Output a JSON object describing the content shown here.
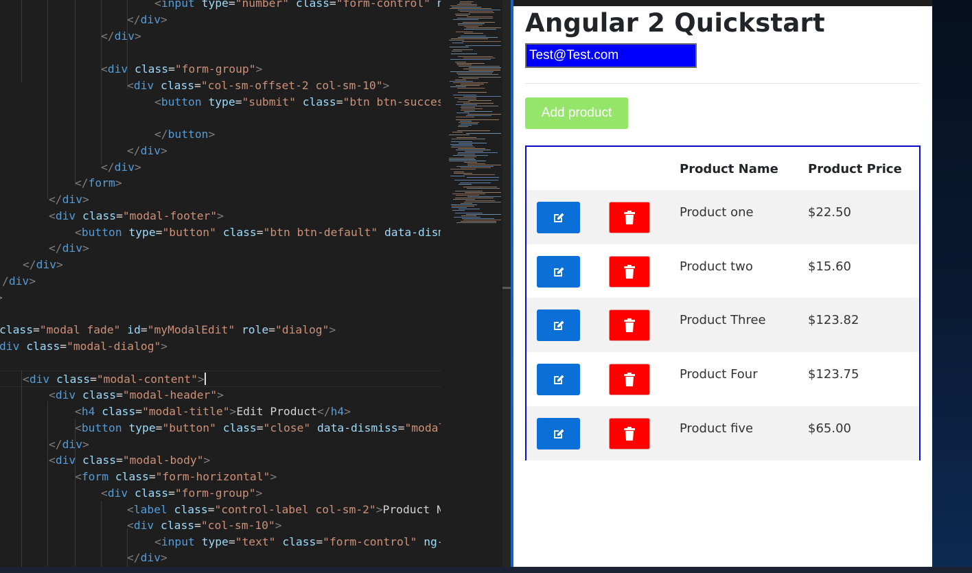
{
  "editor": {
    "lines": [
      [
        [
          "t-punc",
          "<"
        ],
        [
          "t-tag",
          "input"
        ],
        [
          "t-text",
          " "
        ],
        [
          "t-attr",
          "type"
        ],
        [
          "t-text",
          "="
        ],
        [
          "t-str",
          "\"number\""
        ],
        [
          "t-text",
          " "
        ],
        [
          "t-attr",
          "class"
        ],
        [
          "t-text",
          "="
        ],
        [
          "t-str",
          "\"form-control\""
        ],
        [
          "t-text",
          " "
        ],
        [
          "t-attr",
          "ng"
        ]
      ],
      [
        [
          "t-punc",
          "</"
        ],
        [
          "t-tag",
          "div"
        ],
        [
          "t-punc",
          ">"
        ]
      ],
      [
        [
          "t-punc",
          "</"
        ],
        [
          "t-tag",
          "div"
        ],
        [
          "t-punc",
          ">"
        ]
      ],
      [],
      [
        [
          "t-punc",
          "<"
        ],
        [
          "t-tag",
          "div"
        ],
        [
          "t-text",
          " "
        ],
        [
          "t-attr",
          "class"
        ],
        [
          "t-text",
          "="
        ],
        [
          "t-str",
          "\"form-group\""
        ],
        [
          "t-punc",
          ">"
        ]
      ],
      [
        [
          "t-punc",
          "<"
        ],
        [
          "t-tag",
          "div"
        ],
        [
          "t-text",
          " "
        ],
        [
          "t-attr",
          "class"
        ],
        [
          "t-text",
          "="
        ],
        [
          "t-str",
          "\"col-sm-offset-2 col-sm-10\""
        ],
        [
          "t-punc",
          ">"
        ]
      ],
      [
        [
          "t-punc",
          "<"
        ],
        [
          "t-tag",
          "button"
        ],
        [
          "t-text",
          " "
        ],
        [
          "t-attr",
          "type"
        ],
        [
          "t-text",
          "="
        ],
        [
          "t-str",
          "\"submit\""
        ],
        [
          "t-text",
          " "
        ],
        [
          "t-attr",
          "class"
        ],
        [
          "t-text",
          "="
        ],
        [
          "t-str",
          "\"btn btn-success"
        ]
      ],
      [],
      [
        [
          "t-punc",
          "</"
        ],
        [
          "t-tag",
          "button"
        ],
        [
          "t-punc",
          ">"
        ]
      ],
      [
        [
          "t-punc",
          "</"
        ],
        [
          "t-tag",
          "div"
        ],
        [
          "t-punc",
          ">"
        ]
      ],
      [
        [
          "t-punc",
          "</"
        ],
        [
          "t-tag",
          "div"
        ],
        [
          "t-punc",
          ">"
        ]
      ],
      [
        [
          "t-punc",
          "</"
        ],
        [
          "t-tag",
          "form"
        ],
        [
          "t-punc",
          ">"
        ]
      ],
      [
        [
          "t-punc",
          "</"
        ],
        [
          "t-tag",
          "div"
        ],
        [
          "t-punc",
          ">"
        ]
      ],
      [
        [
          "t-punc",
          "<"
        ],
        [
          "t-tag",
          "div"
        ],
        [
          "t-text",
          " "
        ],
        [
          "t-attr",
          "class"
        ],
        [
          "t-text",
          "="
        ],
        [
          "t-str",
          "\"modal-footer\""
        ],
        [
          "t-punc",
          ">"
        ]
      ],
      [
        [
          "t-punc",
          "<"
        ],
        [
          "t-tag",
          "button"
        ],
        [
          "t-text",
          " "
        ],
        [
          "t-attr",
          "type"
        ],
        [
          "t-text",
          "="
        ],
        [
          "t-str",
          "\"button\""
        ],
        [
          "t-text",
          " "
        ],
        [
          "t-attr",
          "class"
        ],
        [
          "t-text",
          "="
        ],
        [
          "t-str",
          "\"btn btn-default\""
        ],
        [
          "t-text",
          " "
        ],
        [
          "t-attr",
          "data-dismi"
        ]
      ],
      [
        [
          "t-punc",
          "</"
        ],
        [
          "t-tag",
          "div"
        ],
        [
          "t-punc",
          ">"
        ]
      ],
      [
        [
          "t-punc",
          "</"
        ],
        [
          "t-tag",
          "div"
        ],
        [
          "t-punc",
          ">"
        ]
      ],
      [
        [
          "t-punc",
          "/"
        ],
        [
          "t-tag",
          "div"
        ],
        [
          "t-punc",
          ">"
        ]
      ],
      [
        [
          "t-punc",
          ">"
        ]
      ],
      [],
      [
        [
          "t-attr",
          "class"
        ],
        [
          "t-text",
          "="
        ],
        [
          "t-str",
          "\"modal fade\""
        ],
        [
          "t-text",
          " "
        ],
        [
          "t-attr",
          "id"
        ],
        [
          "t-text",
          "="
        ],
        [
          "t-str",
          "\"myModalEdit\""
        ],
        [
          "t-text",
          " "
        ],
        [
          "t-attr",
          "role"
        ],
        [
          "t-text",
          "="
        ],
        [
          "t-str",
          "\"dialog\""
        ],
        [
          "t-punc",
          ">"
        ]
      ],
      [
        [
          "t-tag",
          "div"
        ],
        [
          "t-text",
          " "
        ],
        [
          "t-attr",
          "class"
        ],
        [
          "t-text",
          "="
        ],
        [
          "t-str",
          "\"modal-dialog\""
        ],
        [
          "t-punc",
          ">"
        ]
      ],
      [],
      [
        [
          "t-punc",
          "<"
        ],
        [
          "t-tag",
          "div"
        ],
        [
          "t-text",
          " "
        ],
        [
          "t-attr",
          "class"
        ],
        [
          "t-text",
          "="
        ],
        [
          "t-str",
          "\"modal-content\""
        ],
        [
          "t-punc",
          ">"
        ]
      ],
      [
        [
          "t-punc",
          "<"
        ],
        [
          "t-tag",
          "div"
        ],
        [
          "t-text",
          " "
        ],
        [
          "t-attr",
          "class"
        ],
        [
          "t-text",
          "="
        ],
        [
          "t-str",
          "\"modal-header\""
        ],
        [
          "t-punc",
          ">"
        ]
      ],
      [
        [
          "t-punc",
          "<"
        ],
        [
          "t-tag",
          "h4"
        ],
        [
          "t-text",
          " "
        ],
        [
          "t-attr",
          "class"
        ],
        [
          "t-text",
          "="
        ],
        [
          "t-str",
          "\"modal-title\""
        ],
        [
          "t-punc",
          ">"
        ],
        [
          "t-text",
          "Edit Product"
        ],
        [
          "t-punc",
          "</"
        ],
        [
          "t-tag",
          "h4"
        ],
        [
          "t-punc",
          ">"
        ]
      ],
      [
        [
          "t-punc",
          "<"
        ],
        [
          "t-tag",
          "button"
        ],
        [
          "t-text",
          " "
        ],
        [
          "t-attr",
          "type"
        ],
        [
          "t-text",
          "="
        ],
        [
          "t-str",
          "\"button\""
        ],
        [
          "t-text",
          " "
        ],
        [
          "t-attr",
          "class"
        ],
        [
          "t-text",
          "="
        ],
        [
          "t-str",
          "\"close\""
        ],
        [
          "t-text",
          " "
        ],
        [
          "t-attr",
          "data-dismiss"
        ],
        [
          "t-text",
          "="
        ],
        [
          "t-str",
          "\"modal\""
        ]
      ],
      [
        [
          "t-punc",
          "</"
        ],
        [
          "t-tag",
          "div"
        ],
        [
          "t-punc",
          ">"
        ]
      ],
      [
        [
          "t-punc",
          "<"
        ],
        [
          "t-tag",
          "div"
        ],
        [
          "t-text",
          " "
        ],
        [
          "t-attr",
          "class"
        ],
        [
          "t-text",
          "="
        ],
        [
          "t-str",
          "\"modal-body\""
        ],
        [
          "t-punc",
          ">"
        ]
      ],
      [
        [
          "t-punc",
          "<"
        ],
        [
          "t-tag",
          "form"
        ],
        [
          "t-text",
          " "
        ],
        [
          "t-attr",
          "class"
        ],
        [
          "t-text",
          "="
        ],
        [
          "t-str",
          "\"form-horizontal\""
        ],
        [
          "t-punc",
          ">"
        ]
      ],
      [
        [
          "t-punc",
          "<"
        ],
        [
          "t-tag",
          "div"
        ],
        [
          "t-text",
          " "
        ],
        [
          "t-attr",
          "class"
        ],
        [
          "t-text",
          "="
        ],
        [
          "t-str",
          "\"form-group\""
        ],
        [
          "t-punc",
          ">"
        ]
      ],
      [
        [
          "t-punc",
          "<"
        ],
        [
          "t-tag",
          "label"
        ],
        [
          "t-text",
          " "
        ],
        [
          "t-attr",
          "class"
        ],
        [
          "t-text",
          "="
        ],
        [
          "t-str",
          "\"control-label col-sm-2\""
        ],
        [
          "t-punc",
          ">"
        ],
        [
          "t-text",
          "Product Na"
        ]
      ],
      [
        [
          "t-punc",
          "<"
        ],
        [
          "t-tag",
          "div"
        ],
        [
          "t-text",
          " "
        ],
        [
          "t-attr",
          "class"
        ],
        [
          "t-text",
          "="
        ],
        [
          "t-str",
          "\"col-sm-10\""
        ],
        [
          "t-punc",
          ">"
        ]
      ],
      [
        [
          "t-punc",
          "<"
        ],
        [
          "t-tag",
          "input"
        ],
        [
          "t-text",
          " "
        ],
        [
          "t-attr",
          "type"
        ],
        [
          "t-text",
          "="
        ],
        [
          "t-str",
          "\"text\""
        ],
        [
          "t-text",
          " "
        ],
        [
          "t-attr",
          "class"
        ],
        [
          "t-text",
          "="
        ],
        [
          "t-str",
          "\"form-control\""
        ],
        [
          "t-text",
          " "
        ],
        [
          "t-attr",
          "ng-m"
        ]
      ],
      [
        [
          "t-punc",
          "</"
        ],
        [
          "t-tag",
          "div"
        ],
        [
          "t-punc",
          ">"
        ]
      ]
    ]
  },
  "app": {
    "title": "Angular 2 Quickstart",
    "email_value": "Test@Test.com",
    "add_button_label": "Add product",
    "table": {
      "headers": [
        "",
        "",
        "Product Name",
        "Product Price"
      ],
      "rows": [
        {
          "name": "Product one",
          "price": "$22.50"
        },
        {
          "name": "Product two",
          "price": "$15.60"
        },
        {
          "name": "Product Three",
          "price": "$123.82"
        },
        {
          "name": "Product Four",
          "price": "$123.75"
        },
        {
          "name": "Product five",
          "price": "$65.00"
        }
      ]
    }
  },
  "icons": {
    "edit": "edit-icon",
    "delete": "trash-icon"
  },
  "colors": {
    "editor_bg": "#1e1e1e",
    "email_bg": "#0000ff",
    "add_button": "#95e56a",
    "edit_button": "#0a6fd6",
    "delete_button": "#ff0000",
    "table_border": "#0b0bcc"
  }
}
